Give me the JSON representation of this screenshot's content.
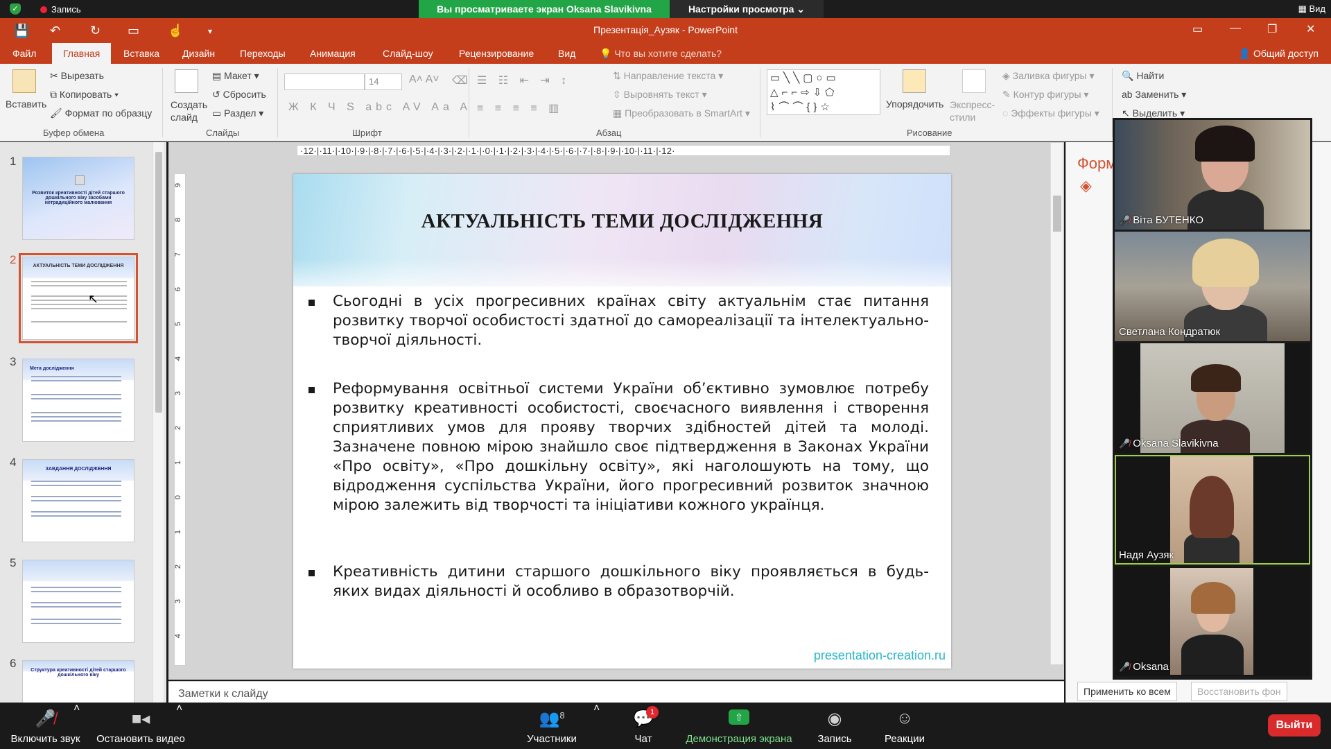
{
  "zoom": {
    "recording_label": "Запись",
    "viewing_banner": "Вы просматриваете экран Oksana Slavikivna",
    "view_options": "Настройки просмотра ⌄",
    "view_label": "Вид"
  },
  "powerpoint": {
    "doc_title": "Презентація_Аузяк - PowerPoint",
    "tabs": [
      "Файл",
      "Главная",
      "Вставка",
      "Дизайн",
      "Переходы",
      "Анимация",
      "Слайд-шоу",
      "Рецензирование",
      "Вид"
    ],
    "tell_me": "Что вы хотите сделать?",
    "share": "Общий доступ",
    "ribbon": {
      "paste": "Вставить",
      "cut": "Вырезать",
      "copy": "Копировать",
      "format_painter": "Формат по образцу",
      "clipboard_group": "Буфер обмена",
      "new_slide": "Создать слайд",
      "layout": "Макет",
      "reset": "Сбросить",
      "section": "Раздел",
      "slides_group": "Слайды",
      "font_size": "14",
      "font_group": "Шрифт",
      "text_direction": "Направление текста",
      "align_text": "Выровнять текст",
      "smartart": "Преобразовать в SmartArt",
      "paragraph_group": "Абзац",
      "arrange": "Упорядочить",
      "quick_styles": "Экспресс-стили",
      "shape_fill": "Заливка фигуры",
      "shape_outline": "Контур фигуры",
      "shape_effects": "Эффекты фигуры",
      "drawing_group": "Рисование",
      "find": "Найти",
      "replace": "Заменить",
      "select": "Выделить"
    },
    "ruler_text": "·12·|·11·|·10·|·9·|·8·|·7·|·6·|·5·|·4·|·3·|·2·|·1·|·0·|·1·|·2·|·3·|·4·|·5·|·6·|·7·|·8·|·9·|·10·|·11·|·12·",
    "thumbnails": [
      {
        "num": "1",
        "title": "Розвиток креативності дітей старшого дошкільного віку засобами нетрадиційного малювання"
      },
      {
        "num": "2",
        "title": "АКТУАЛЬНІСТЬ ТЕМИ ДОСЛІДЖЕННЯ"
      },
      {
        "num": "3",
        "title": "Мета дослідження"
      },
      {
        "num": "4",
        "title": "ЗАВДАННЯ ДОСЛІДЖЕННЯ"
      },
      {
        "num": "5",
        "title": ""
      },
      {
        "num": "6",
        "title": "Структура креативності дітей старшого дошкільного віку"
      }
    ],
    "slide": {
      "title": "АКТУАЛЬНІСТЬ ТЕМИ ДОСЛІДЖЕННЯ",
      "bullets": [
        "Сьогодні в усіх прогресивних країнах світу  актуальнім стає питання розвитку творчої особистості здатної до самореалізації та інтелектуально-творчої діяльності.",
        "Реформування освітньої системи України об’єктивно зумовлює потребу розвитку креативності особистості, своєчасного виявлення і створення сприятливих умов для прояву творчих здібностей дітей та молоді. Зазначене повною мірою знайшло своє підтвердження в Законах України «Про освіту», «Про дошкільну освіту», які наголошують на тому, що відродження суспільства України, його прогресивний розвиток значною мірою залежить від творчості та ініціативи кожного українця.",
        "Креативність дитини старшого дошкільного віку проявляється в будь-яких видах діяльності й особливо в образотворчій."
      ],
      "watermark": "presentation-creation.ru"
    },
    "notes_placeholder": "Заметки к слайду",
    "format_pane": {
      "title": "Форм",
      "apply_all": "Применить ко всем",
      "reset_bg": "Восстановить фон"
    }
  },
  "participants": [
    {
      "name": "Віта БУТЕНКО",
      "muted": true
    },
    {
      "name": "Светлана Кондратюк",
      "muted": false
    },
    {
      "name": "Oksana Slavikivna",
      "muted": true
    },
    {
      "name": "Надя Аузяк",
      "muted": false
    },
    {
      "name": "Oksana",
      "muted": true
    }
  ],
  "toolbar": {
    "unmute": "Включить звук",
    "stop_video": "Остановить видео",
    "participants": "Участники",
    "participants_count": "8",
    "chat": "Чат",
    "chat_badge": "1",
    "share_screen": "Демонстрация экрана",
    "record": "Запись",
    "reactions": "Реакции",
    "leave": "Выйти"
  }
}
